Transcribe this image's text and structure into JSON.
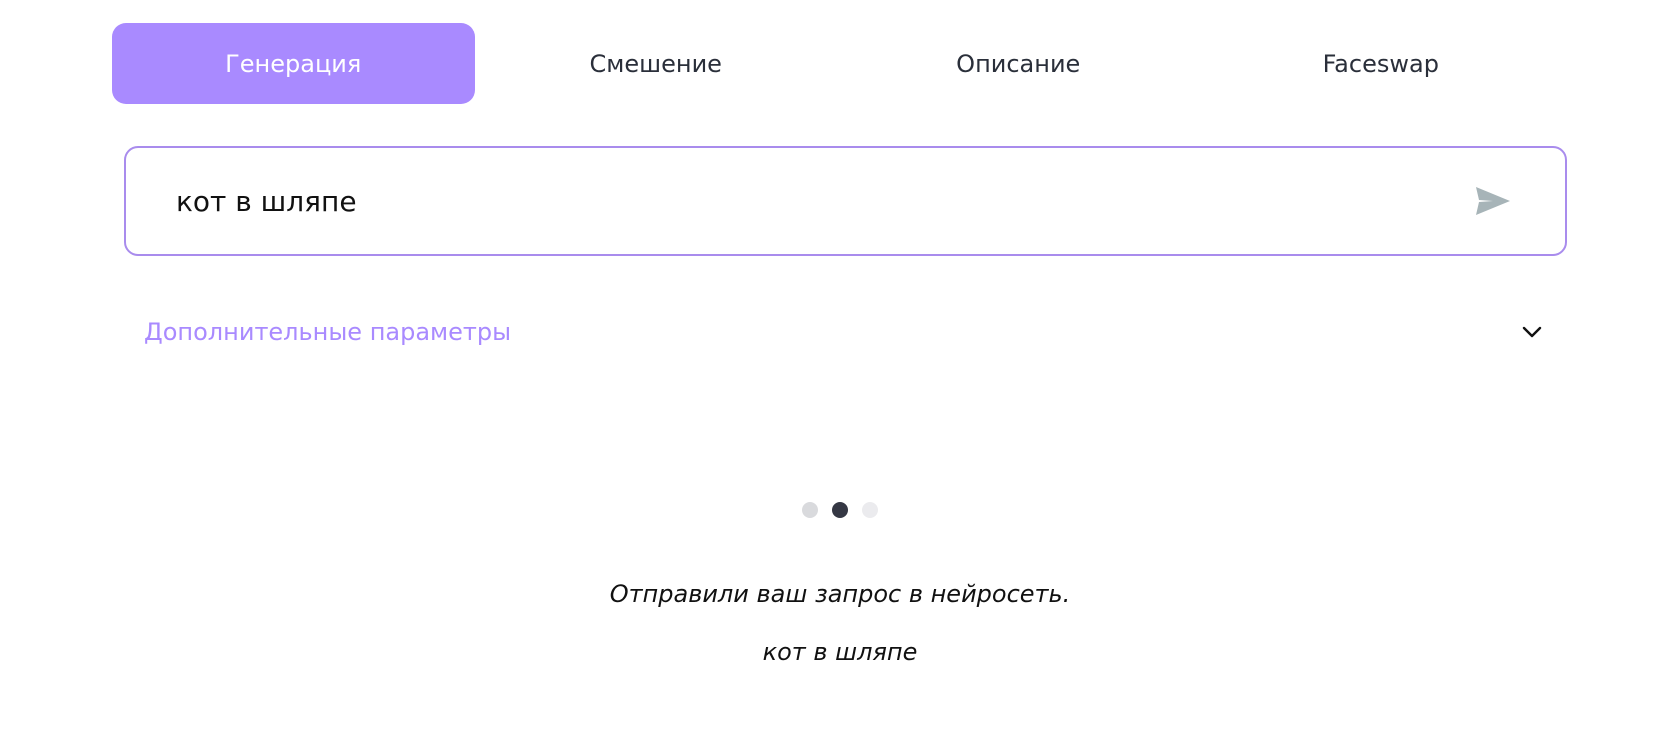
{
  "tabs": [
    {
      "label": "Генерация",
      "active": true
    },
    {
      "label": "Смешение",
      "active": false
    },
    {
      "label": "Описание",
      "active": false
    },
    {
      "label": "Faceswap",
      "active": false
    }
  ],
  "prompt": {
    "value": "кот в шляпе",
    "send_icon": "send-icon"
  },
  "params": {
    "label": "Дополнительные параметры",
    "icon": "chevron-down-icon"
  },
  "loader": {
    "dot_count": 3,
    "active_index": 1,
    "colors": [
      "#d9dadd",
      "#353844",
      "#ebebee"
    ]
  },
  "status": {
    "message": "Отправили ваш запрос в нейросеть.",
    "prompt_echo": "кот в шляпе"
  },
  "colors": {
    "accent": "#a98aff",
    "input_border": "#a98ced",
    "send_icon": "#a7b4b8"
  }
}
